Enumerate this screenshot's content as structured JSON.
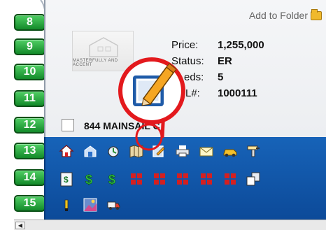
{
  "rail": {
    "numbers": [
      "8",
      "9",
      "10",
      "11",
      "12",
      "13",
      "14",
      "15"
    ]
  },
  "card": {
    "add_to_folder": "Add to Folder",
    "thumbnail_caption": "MASTERFULLY AND ACCENT",
    "fields": [
      {
        "label": "Price:",
        "value": "1,255,000"
      },
      {
        "label": "Status:",
        "value": "ER"
      },
      {
        "label": "eds:",
        "value": "5"
      },
      {
        "label": "L#:",
        "value": "1000111"
      }
    ],
    "address": "844 MAINSAIL C"
  },
  "toolbar": {
    "row1": [
      "home-icon",
      "building-icon",
      "rotate-icon",
      "map-icon",
      "edit-icon",
      "print-icon",
      "email-icon",
      "car-icon",
      "tools-icon"
    ],
    "row2": [
      "document-icon",
      "money-icon",
      "money-icon",
      "coop-icon",
      "coop-icon",
      "coop-icon",
      "coop-icon",
      "coop-icon",
      "copy-icon"
    ],
    "row3": [
      "marker-icon",
      "photos-icon",
      "truck-icon"
    ],
    "colors": {
      "bar": "#1763b8",
      "highlight": "#e3191d",
      "rail_green": "#138a2a"
    }
  }
}
